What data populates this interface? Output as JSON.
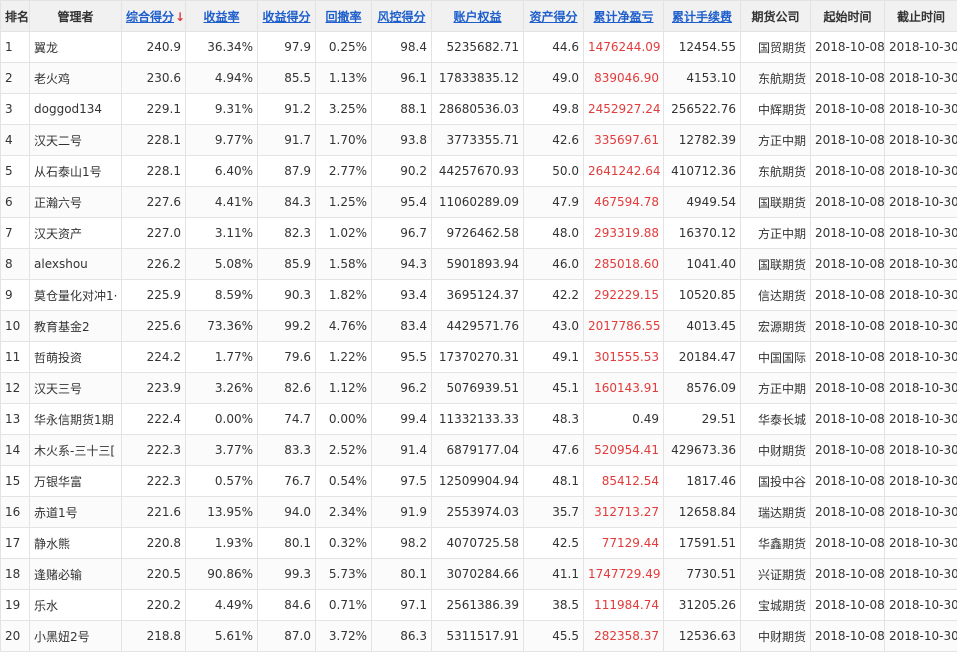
{
  "table": {
    "headers": [
      {
        "key": "rank",
        "label": "排名",
        "sortable": false
      },
      {
        "key": "manager",
        "label": "管理者",
        "sortable": false
      },
      {
        "key": "composite_score",
        "label": "综合得分",
        "sortable": true,
        "sorted": true,
        "sort_glyph": "↓"
      },
      {
        "key": "return_rate",
        "label": "收益率",
        "sortable": true
      },
      {
        "key": "return_score",
        "label": "收益得分",
        "sortable": true
      },
      {
        "key": "drawdown",
        "label": "回撤率",
        "sortable": true
      },
      {
        "key": "risk_score",
        "label": "风控得分",
        "sortable": true
      },
      {
        "key": "equity",
        "label": "账户权益",
        "sortable": true
      },
      {
        "key": "asset_score",
        "label": "资产得分",
        "sortable": true
      },
      {
        "key": "net_pl",
        "label": "累计净盈亏",
        "sortable": true
      },
      {
        "key": "fees",
        "label": "累计手续费",
        "sortable": true
      },
      {
        "key": "broker",
        "label": "期货公司",
        "sortable": false
      },
      {
        "key": "start",
        "label": "起始时间",
        "sortable": false
      },
      {
        "key": "end",
        "label": "截止时间",
        "sortable": false
      }
    ],
    "rows": [
      {
        "rank": "1",
        "manager": "翼龙",
        "composite_score": "240.9",
        "return_rate": "36.34%",
        "return_score": "97.9",
        "drawdown": "0.25%",
        "risk_score": "98.4",
        "equity": "5235682.71",
        "asset_score": "44.6",
        "net_pl": "1476244.09",
        "net_pl_red": true,
        "fees": "12454.55",
        "broker": "国贸期货",
        "start": "2018-10-08",
        "end": "2018-10-30"
      },
      {
        "rank": "2",
        "manager": "老火鸡",
        "composite_score": "230.6",
        "return_rate": "4.94%",
        "return_score": "85.5",
        "drawdown": "1.13%",
        "risk_score": "96.1",
        "equity": "17833835.12",
        "asset_score": "49.0",
        "net_pl": "839046.90",
        "net_pl_red": true,
        "fees": "4153.10",
        "broker": "东航期货",
        "start": "2018-10-08",
        "end": "2018-10-30"
      },
      {
        "rank": "3",
        "manager": "doggod134",
        "composite_score": "229.1",
        "return_rate": "9.31%",
        "return_score": "91.2",
        "drawdown": "3.25%",
        "risk_score": "88.1",
        "equity": "28680536.03",
        "asset_score": "49.8",
        "net_pl": "2452927.24",
        "net_pl_red": true,
        "fees": "256522.76",
        "broker": "中辉期货",
        "start": "2018-10-08",
        "end": "2018-10-30"
      },
      {
        "rank": "4",
        "manager": "汉天二号",
        "composite_score": "228.1",
        "return_rate": "9.77%",
        "return_score": "91.7",
        "drawdown": "1.70%",
        "risk_score": "93.8",
        "equity": "3773355.71",
        "asset_score": "42.6",
        "net_pl": "335697.61",
        "net_pl_red": true,
        "fees": "12782.39",
        "broker": "方正中期",
        "start": "2018-10-08",
        "end": "2018-10-30"
      },
      {
        "rank": "5",
        "manager": "从石泰山1号",
        "composite_score": "228.1",
        "return_rate": "6.40%",
        "return_score": "87.9",
        "drawdown": "2.77%",
        "risk_score": "90.2",
        "equity": "44257670.93",
        "asset_score": "50.0",
        "net_pl": "2641242.64",
        "net_pl_red": true,
        "fees": "410712.36",
        "broker": "东航期货",
        "start": "2018-10-08",
        "end": "2018-10-30"
      },
      {
        "rank": "6",
        "manager": "正瀚六号",
        "composite_score": "227.6",
        "return_rate": "4.41%",
        "return_score": "84.3",
        "drawdown": "1.25%",
        "risk_score": "95.4",
        "equity": "11060289.09",
        "asset_score": "47.9",
        "net_pl": "467594.78",
        "net_pl_red": true,
        "fees": "4949.54",
        "broker": "国联期货",
        "start": "2018-10-08",
        "end": "2018-10-30"
      },
      {
        "rank": "7",
        "manager": "汉天资产",
        "composite_score": "227.0",
        "return_rate": "3.11%",
        "return_score": "82.3",
        "drawdown": "1.02%",
        "risk_score": "96.7",
        "equity": "9726462.58",
        "asset_score": "48.0",
        "net_pl": "293319.88",
        "net_pl_red": true,
        "fees": "16370.12",
        "broker": "方正中期",
        "start": "2018-10-08",
        "end": "2018-10-30"
      },
      {
        "rank": "8",
        "manager": "alexshou",
        "composite_score": "226.2",
        "return_rate": "5.08%",
        "return_score": "85.9",
        "drawdown": "1.58%",
        "risk_score": "94.3",
        "equity": "5901893.94",
        "asset_score": "46.0",
        "net_pl": "285018.60",
        "net_pl_red": true,
        "fees": "1041.40",
        "broker": "国联期货",
        "start": "2018-10-08",
        "end": "2018-10-30"
      },
      {
        "rank": "9",
        "manager": "莫仓量化对冲1·",
        "composite_score": "225.9",
        "return_rate": "8.59%",
        "return_score": "90.3",
        "drawdown": "1.82%",
        "risk_score": "93.4",
        "equity": "3695124.37",
        "asset_score": "42.2",
        "net_pl": "292229.15",
        "net_pl_red": true,
        "fees": "10520.85",
        "broker": "信达期货",
        "start": "2018-10-08",
        "end": "2018-10-30"
      },
      {
        "rank": "10",
        "manager": "教育基金2",
        "composite_score": "225.6",
        "return_rate": "73.36%",
        "return_score": "99.2",
        "drawdown": "4.76%",
        "risk_score": "83.4",
        "equity": "4429571.76",
        "asset_score": "43.0",
        "net_pl": "2017786.55",
        "net_pl_red": true,
        "fees": "4013.45",
        "broker": "宏源期货",
        "start": "2018-10-08",
        "end": "2018-10-30"
      },
      {
        "rank": "11",
        "manager": "哲萌投资",
        "composite_score": "224.2",
        "return_rate": "1.77%",
        "return_score": "79.6",
        "drawdown": "1.22%",
        "risk_score": "95.5",
        "equity": "17370270.31",
        "asset_score": "49.1",
        "net_pl": "301555.53",
        "net_pl_red": true,
        "fees": "20184.47",
        "broker": "中国国际",
        "start": "2018-10-08",
        "end": "2018-10-30"
      },
      {
        "rank": "12",
        "manager": "汉天三号",
        "composite_score": "223.9",
        "return_rate": "3.26%",
        "return_score": "82.6",
        "drawdown": "1.12%",
        "risk_score": "96.2",
        "equity": "5076939.51",
        "asset_score": "45.1",
        "net_pl": "160143.91",
        "net_pl_red": true,
        "fees": "8576.09",
        "broker": "方正中期",
        "start": "2018-10-08",
        "end": "2018-10-30"
      },
      {
        "rank": "13",
        "manager": "华永信期货1期",
        "composite_score": "222.4",
        "return_rate": "0.00%",
        "return_score": "74.7",
        "drawdown": "0.00%",
        "risk_score": "99.4",
        "equity": "11332133.33",
        "asset_score": "48.3",
        "net_pl": "0.49",
        "net_pl_red": false,
        "fees": "29.51",
        "broker": "华泰长城",
        "start": "2018-10-08",
        "end": "2018-10-30"
      },
      {
        "rank": "14",
        "manager": "木火系-三十三[",
        "composite_score": "222.3",
        "return_rate": "3.77%",
        "return_score": "83.3",
        "drawdown": "2.52%",
        "risk_score": "91.4",
        "equity": "6879177.04",
        "asset_score": "47.6",
        "net_pl": "520954.41",
        "net_pl_red": true,
        "fees": "429673.36",
        "broker": "中财期货",
        "start": "2018-10-08",
        "end": "2018-10-30"
      },
      {
        "rank": "15",
        "manager": "万银华富",
        "composite_score": "222.3",
        "return_rate": "0.57%",
        "return_score": "76.7",
        "drawdown": "0.54%",
        "risk_score": "97.5",
        "equity": "12509904.94",
        "asset_score": "48.1",
        "net_pl": "85412.54",
        "net_pl_red": true,
        "fees": "1817.46",
        "broker": "国投中谷",
        "start": "2018-10-08",
        "end": "2018-10-30"
      },
      {
        "rank": "16",
        "manager": "赤道1号",
        "composite_score": "221.6",
        "return_rate": "13.95%",
        "return_score": "94.0",
        "drawdown": "2.34%",
        "risk_score": "91.9",
        "equity": "2553974.03",
        "asset_score": "35.7",
        "net_pl": "312713.27",
        "net_pl_red": true,
        "fees": "12658.84",
        "broker": "瑞达期货",
        "start": "2018-10-08",
        "end": "2018-10-30"
      },
      {
        "rank": "17",
        "manager": "静水熊",
        "composite_score": "220.8",
        "return_rate": "1.93%",
        "return_score": "80.1",
        "drawdown": "0.32%",
        "risk_score": "98.2",
        "equity": "4070725.58",
        "asset_score": "42.5",
        "net_pl": "77129.44",
        "net_pl_red": true,
        "fees": "17591.51",
        "broker": "华鑫期货",
        "start": "2018-10-08",
        "end": "2018-10-30"
      },
      {
        "rank": "18",
        "manager": "逢赌必输",
        "composite_score": "220.5",
        "return_rate": "90.86%",
        "return_score": "99.3",
        "drawdown": "5.73%",
        "risk_score": "80.1",
        "equity": "3070284.66",
        "asset_score": "41.1",
        "net_pl": "1747729.49",
        "net_pl_red": true,
        "fees": "7730.51",
        "broker": "兴证期货",
        "start": "2018-10-08",
        "end": "2018-10-30"
      },
      {
        "rank": "19",
        "manager": "乐水",
        "composite_score": "220.2",
        "return_rate": "4.49%",
        "return_score": "84.6",
        "drawdown": "0.71%",
        "risk_score": "97.1",
        "equity": "2561386.39",
        "asset_score": "38.5",
        "net_pl": "111984.74",
        "net_pl_red": true,
        "fees": "31205.26",
        "broker": "宝城期货",
        "start": "2018-10-08",
        "end": "2018-10-30"
      },
      {
        "rank": "20",
        "manager": "小黑妞2号",
        "composite_score": "218.8",
        "return_rate": "5.61%",
        "return_score": "87.0",
        "drawdown": "3.72%",
        "risk_score": "86.3",
        "equity": "5311517.91",
        "asset_score": "45.5",
        "net_pl": "282358.37",
        "net_pl_red": true,
        "fees": "12536.63",
        "broker": "中财期货",
        "start": "2018-10-08",
        "end": "2018-10-30"
      }
    ]
  },
  "colors": {
    "link": "#1f5fcc",
    "sort_arrow": "#e03a3a",
    "profit_red": "#e23b3b",
    "header_bg": "#f1f1f1",
    "border": "#e3e3e3"
  }
}
